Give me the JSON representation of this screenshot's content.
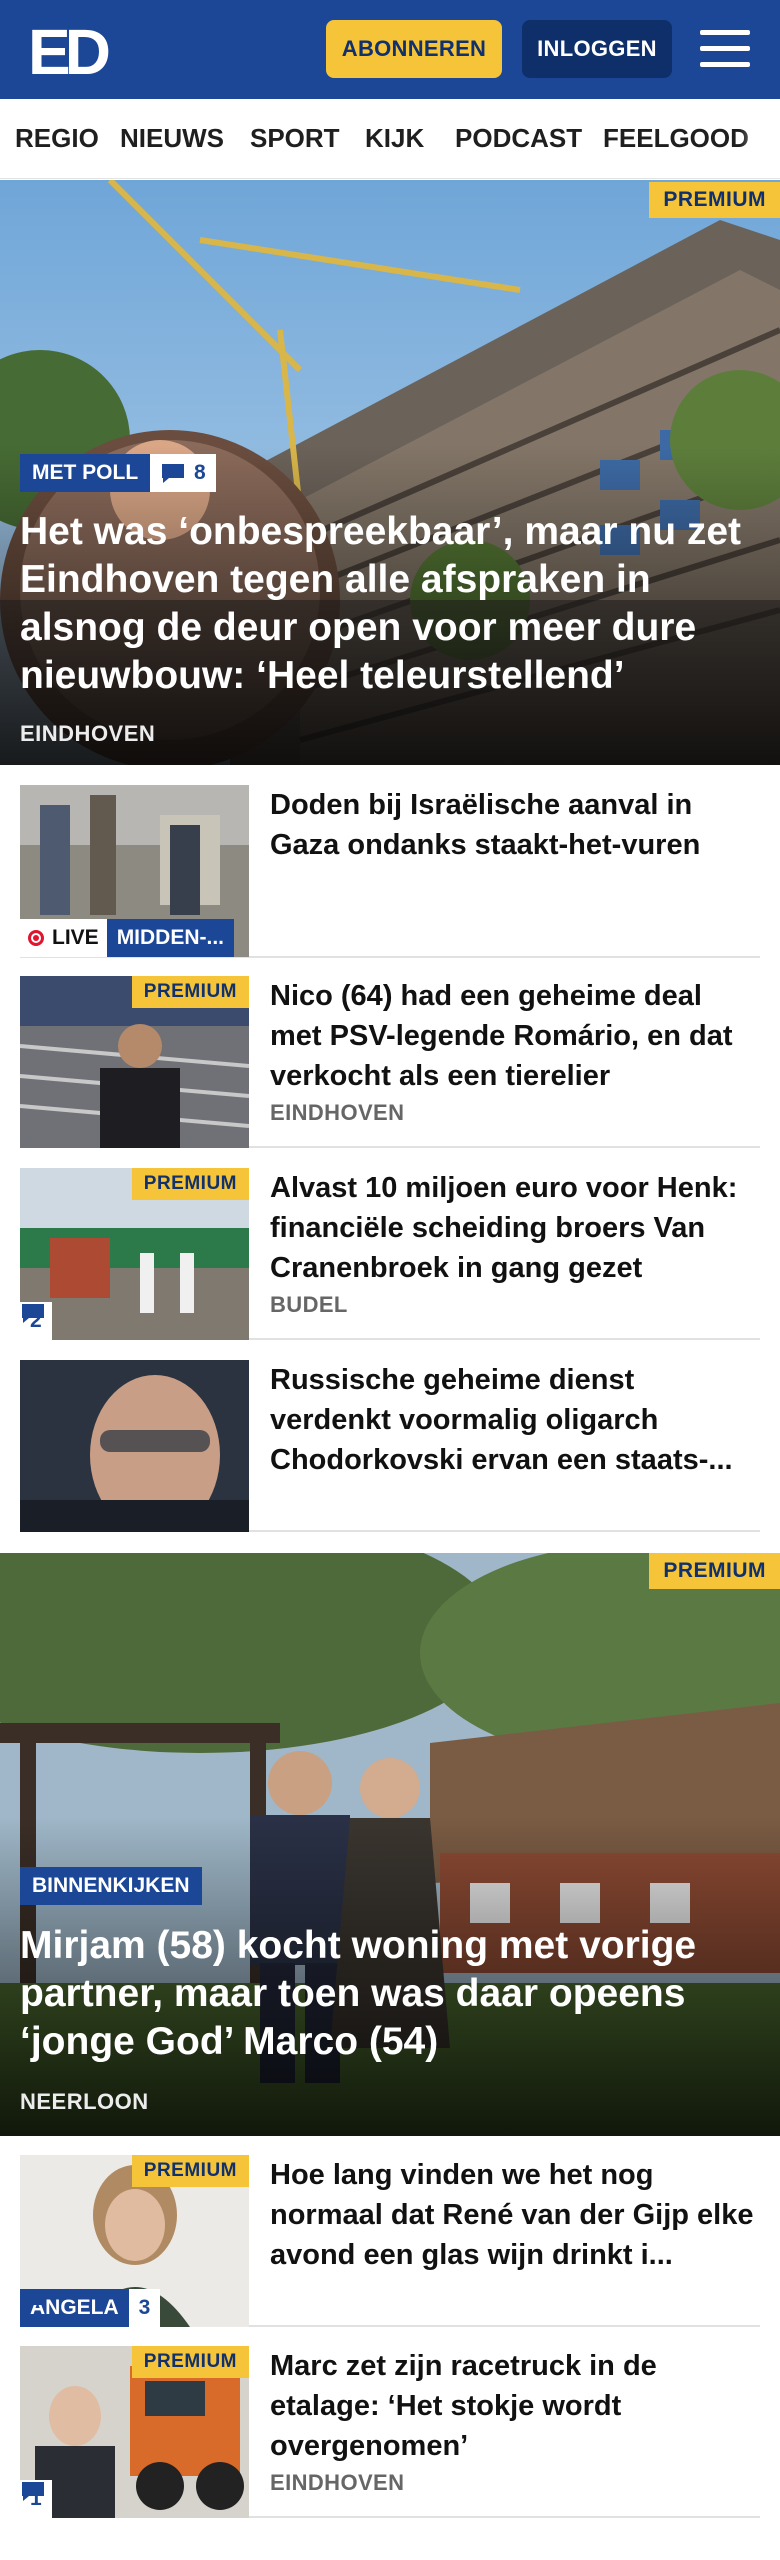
{
  "header": {
    "logo_text": "ED",
    "subscribe_label": "ABONNEREN",
    "login_label": "INLOGGEN",
    "menu_icon": "hamburger-icon"
  },
  "nav": {
    "items": [
      "REGIO",
      "NIEUWS",
      "SPORT",
      "KIJK",
      "PODCAST",
      "FEELGOOD"
    ]
  },
  "hero1": {
    "premium": "PREMIUM",
    "tag": "MET POLL",
    "comments": "8",
    "title": "Het was ‘onbespreekbaar’, maar nu zet Eindhoven tegen alle afspraken in alsnog de deur open voor meer dure nieuwbouw: ‘Heel teleurstellend’",
    "place": "EINDHOVEN"
  },
  "list1": [
    {
      "title": "Doden bij Israëlische aanval in Gaza ondanks staakt-het-vuren",
      "live": "LIVE",
      "section": "MIDDEN-..."
    },
    {
      "premium": "PREMIUM",
      "title": "Nico (64) had een geheime deal met PSV-legende Romário, en dat verkocht als een tierelier",
      "place": "EINDHOVEN"
    },
    {
      "premium": "PREMIUM",
      "title": "Alvast 10 miljoen euro voor Henk: financiële scheiding broers Van Cranenbroek in gang gezet",
      "place": "BUDEL",
      "comments": "2"
    },
    {
      "title": "Russische geheime dienst verdenkt voormalig oligarch Chodorkovski ervan een staats-..."
    }
  ],
  "hero2": {
    "premium": "PREMIUM",
    "tag": "BINNENKIJKEN",
    "title": "Mirjam (58) kocht woning met vorige partner, maar toen was daar opeens ‘jonge God’ Marco (54)",
    "place": "NEERLOON"
  },
  "list2": [
    {
      "premium": "PREMIUM",
      "title": "Hoe lang vinden we het nog normaal dat René van der Gijp elke avond een glas wijn drinkt i...",
      "section": "ANGELA",
      "comments": "3"
    },
    {
      "premium": "PREMIUM",
      "title": "Marc zet zijn racetruck in de etalage: ‘Het stokje wordt overgenomen’",
      "place": "EINDHOVEN",
      "comments": "1"
    }
  ],
  "colors": {
    "brand_blue": "#1c4796",
    "premium_yellow": "#f5c439",
    "live_red": "#e0152e"
  }
}
